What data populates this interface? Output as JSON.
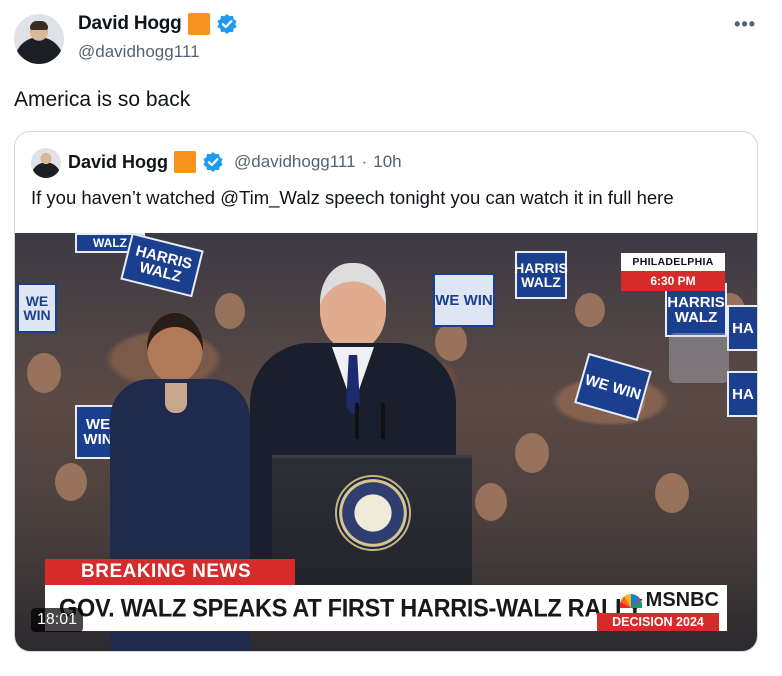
{
  "author": {
    "display_name": "David Hogg",
    "handle": "@davidhogg111"
  },
  "menu_icon": "more-icon",
  "tweet_text": "America is so back",
  "quoted_tweet": {
    "display_name": "David Hogg",
    "handle": "@davidhogg111",
    "separator": "·",
    "time": "10h",
    "text": "If you haven’t watched @Tim_Walz speech tonight you can watch it in full here"
  },
  "video": {
    "duration": "18:01",
    "location_city": "PHILADELPHIA",
    "location_time": "6:30 PM",
    "breaking_label": "BREAKING NEWS",
    "headline": "GOV. WALZ SPEAKS AT FIRST HARRIS-WALZ RALLY",
    "network": "MSNBC",
    "network_tag": "DECISION 2024",
    "signs": [
      "HARRIS WALZ",
      "WE WIN",
      "WE WIN",
      "HARRIS WALZ",
      "HARRIS WALZ",
      "WE WIN",
      "WE WIN",
      "HA",
      "HA",
      "WALZ"
    ]
  },
  "colors": {
    "accent_orange": "#f7931e",
    "verified_blue": "#1d9bf0",
    "breaking_red": "#d52b2b",
    "sign_blue": "#1b3f8f"
  }
}
